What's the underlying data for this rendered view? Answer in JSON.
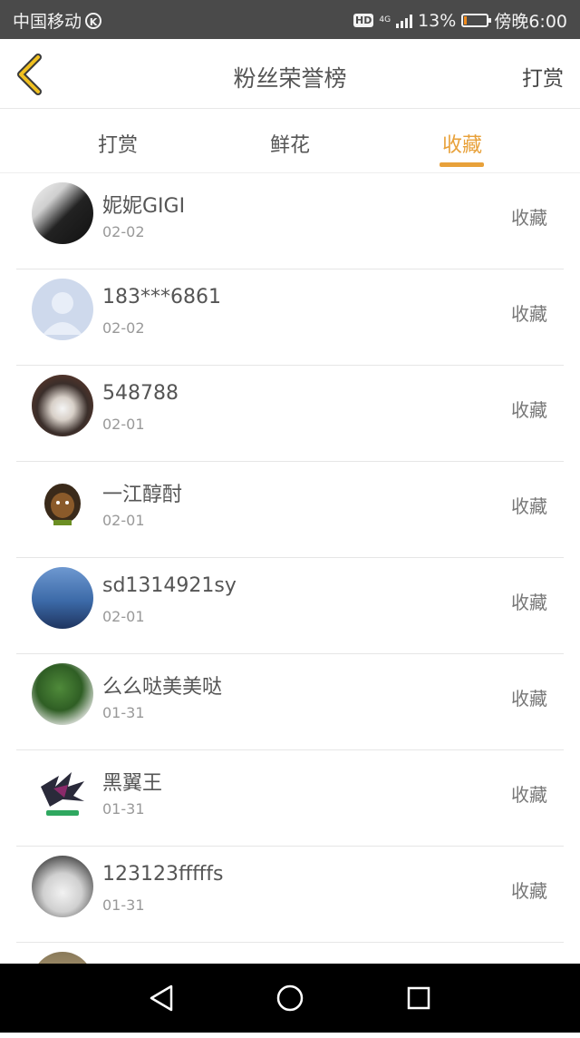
{
  "status_bar": {
    "carrier": "中国移动",
    "hd": "HD",
    "network": "4G",
    "battery_percent": "13%",
    "battery_level": 0.13,
    "time": "傍晚6:00"
  },
  "header": {
    "title": "粉丝荣誉榜",
    "right_action": "打赏"
  },
  "tabs": [
    {
      "label": "打赏",
      "active": false
    },
    {
      "label": "鲜花",
      "active": false
    },
    {
      "label": "收藏",
      "active": true
    }
  ],
  "accent_color": "#e8a13a",
  "fans": [
    {
      "name": "妮妮GIGI",
      "date": "02-02",
      "action": "收藏"
    },
    {
      "name": "183***6861",
      "date": "02-02",
      "action": "收藏"
    },
    {
      "name": "548788",
      "date": "02-01",
      "action": "收藏"
    },
    {
      "name": "一江醇酎",
      "date": "02-01",
      "action": "收藏"
    },
    {
      "name": "sd1314921sy",
      "date": "02-01",
      "action": "收藏"
    },
    {
      "name": "么么哒美美哒",
      "date": "01-31",
      "action": "收藏"
    },
    {
      "name": "黑翼王",
      "date": "01-31",
      "action": "收藏"
    },
    {
      "name": "123123fffffs",
      "date": "01-31",
      "action": "收藏"
    }
  ]
}
